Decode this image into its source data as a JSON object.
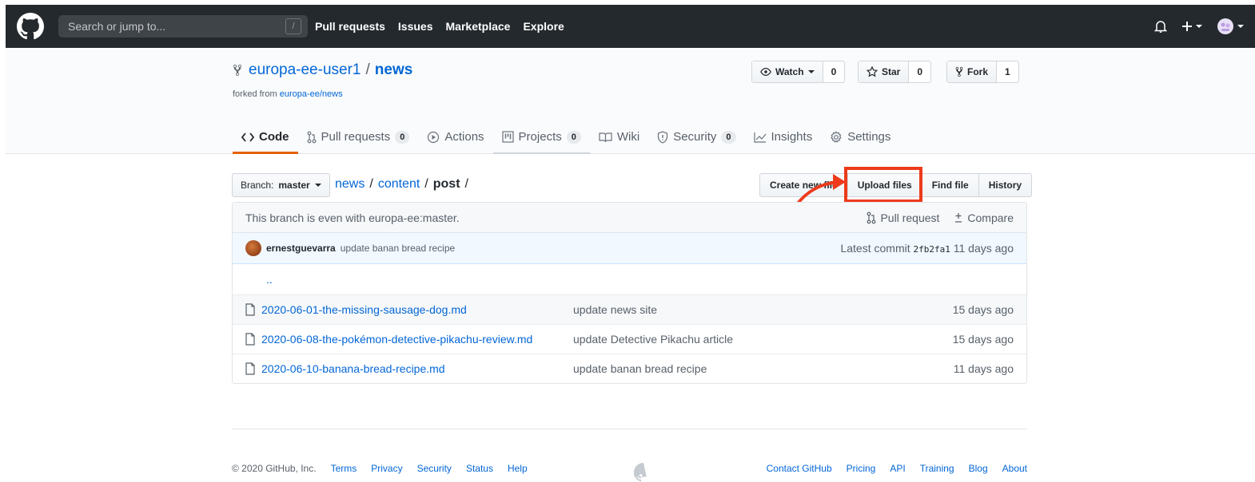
{
  "header": {
    "search_placeholder": "Search or jump to...",
    "search_key": "/",
    "nav": [
      "Pull requests",
      "Issues",
      "Marketplace",
      "Explore"
    ]
  },
  "repo": {
    "owner": "europa-ee-user1",
    "separator": "/",
    "name": "news",
    "forked_prefix": "forked from",
    "forked_source": "europa-ee/news",
    "watch_label": "Watch",
    "watch_count": "0",
    "star_label": "Star",
    "star_count": "0",
    "fork_label": "Fork",
    "fork_count": "1"
  },
  "tabs": [
    {
      "label": "Code"
    },
    {
      "label": "Pull requests",
      "count": "0"
    },
    {
      "label": "Actions"
    },
    {
      "label": "Projects",
      "count": "0"
    },
    {
      "label": "Wiki"
    },
    {
      "label": "Security",
      "count": "0"
    },
    {
      "label": "Insights"
    },
    {
      "label": "Settings"
    }
  ],
  "filenav": {
    "branch_prefix": "Branch:",
    "branch": "master",
    "path": [
      "news",
      "content",
      "post"
    ],
    "sep": "/",
    "buttons": [
      "Create new file",
      "Upload files",
      "Find file",
      "History"
    ]
  },
  "branch_status": {
    "text": "This branch is even with europa-ee:master.",
    "pull_request": "Pull request",
    "compare": "Compare"
  },
  "latest_commit": {
    "author": "ernestguevarra",
    "message": "update banan bread recipe",
    "label": "Latest commit",
    "sha": "2fb2fa1",
    "age": "11 days ago"
  },
  "files": {
    "up": "..",
    "rows": [
      {
        "name": "2020-06-01-the-missing-sausage-dog.md",
        "message": "update news site",
        "age": "15 days ago"
      },
      {
        "name": "2020-06-08-the-pokémon-detective-pikachu-review.md",
        "message": "update Detective Pikachu article",
        "age": "15 days ago"
      },
      {
        "name": "2020-06-10-banana-bread-recipe.md",
        "message": "update banan bread recipe",
        "age": "11 days ago"
      }
    ]
  },
  "footer": {
    "copyright": "© 2020 GitHub, Inc.",
    "left_links": [
      "Terms",
      "Privacy",
      "Security",
      "Status",
      "Help"
    ],
    "right_links": [
      "Contact GitHub",
      "Pricing",
      "API",
      "Training",
      "Blog",
      "About"
    ]
  },
  "colors": {
    "header_bg": "#24292e",
    "link": "#0366d6",
    "highlight": "#ed3b1c",
    "tab_active": "#e36209"
  }
}
